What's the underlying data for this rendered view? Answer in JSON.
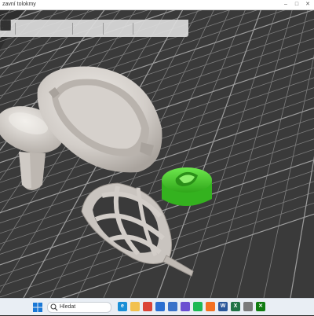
{
  "window": {
    "title": "zavní tolokmy"
  },
  "toolbar": {
    "buttons": [
      "cube-icon",
      "delete-icon",
      "arrange-icon",
      "copy-icon",
      "paste-icon",
      "add-instance-icon",
      "remove-instance-icon",
      "split-objects-icon",
      "split-parts-icon",
      "search-icon",
      "layers-icon",
      "undo-icon",
      "redo-icon"
    ]
  },
  "taskbar": {
    "search_text": "Hledat",
    "apps": [
      {
        "name": "edge",
        "color": "#1a8fd6",
        "glyph": "e"
      },
      {
        "name": "files",
        "color": "#f2c14e",
        "glyph": ""
      },
      {
        "name": "chrome",
        "color": "#db4437",
        "glyph": ""
      },
      {
        "name": "mail",
        "color": "#2b6fd1",
        "glyph": ""
      },
      {
        "name": "store",
        "color": "#3a72c9",
        "glyph": ""
      },
      {
        "name": "photos",
        "color": "#6b4fd1",
        "glyph": ""
      },
      {
        "name": "spotify",
        "color": "#1db954",
        "glyph": ""
      },
      {
        "name": "prusa",
        "color": "#f37021",
        "glyph": ""
      },
      {
        "name": "word",
        "color": "#2b579a",
        "glyph": "W"
      },
      {
        "name": "excel",
        "color": "#217346",
        "glyph": "X"
      },
      {
        "name": "settings",
        "color": "#7a7a7a",
        "glyph": ""
      },
      {
        "name": "game",
        "color": "#107c10",
        "glyph": "✕"
      }
    ]
  },
  "colors": {
    "bed": "#3a3a3a",
    "grid": "#8a8a8a",
    "part": "#d8d4d0",
    "selected": "#4dd02c"
  }
}
